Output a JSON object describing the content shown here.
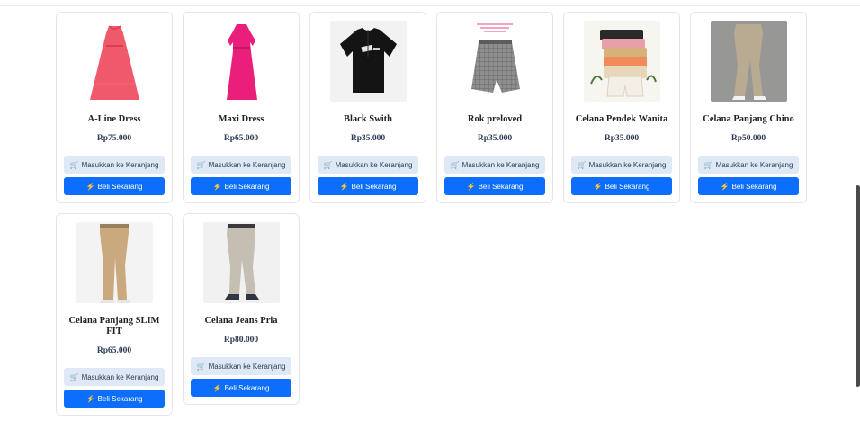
{
  "products": [
    {
      "name": "A-Line Dress",
      "price": "Rp75.000",
      "thumb": "aline"
    },
    {
      "name": "Maxi Dress",
      "price": "Rp65.000",
      "thumb": "maxi"
    },
    {
      "name": "Black Swith",
      "price": "Rp35.000",
      "thumb": "shirt"
    },
    {
      "name": "Rok preloved",
      "price": "Rp35.000",
      "thumb": "skirt"
    },
    {
      "name": "Celana Pendek Wanita",
      "price": "Rp35.000",
      "thumb": "shorts"
    },
    {
      "name": "Celana Panjang Chino",
      "price": "Rp50.000",
      "thumb": "chino"
    },
    {
      "name": "Celana Panjang SLIM FIT",
      "price": "Rp65.000",
      "thumb": "slimfit"
    },
    {
      "name": "Celana Jeans Pria",
      "price": "Rp80.000",
      "thumb": "jeans"
    }
  ],
  "buttons": {
    "cart_label": "Masukkan ke Keranjang",
    "cart_icon": "cart-icon",
    "buy_label": "Beli Sekarang",
    "buy_icon": "bolt-icon"
  },
  "colors": {
    "accent": "#0d6efd",
    "cart_bg": "#dfe9f5"
  }
}
